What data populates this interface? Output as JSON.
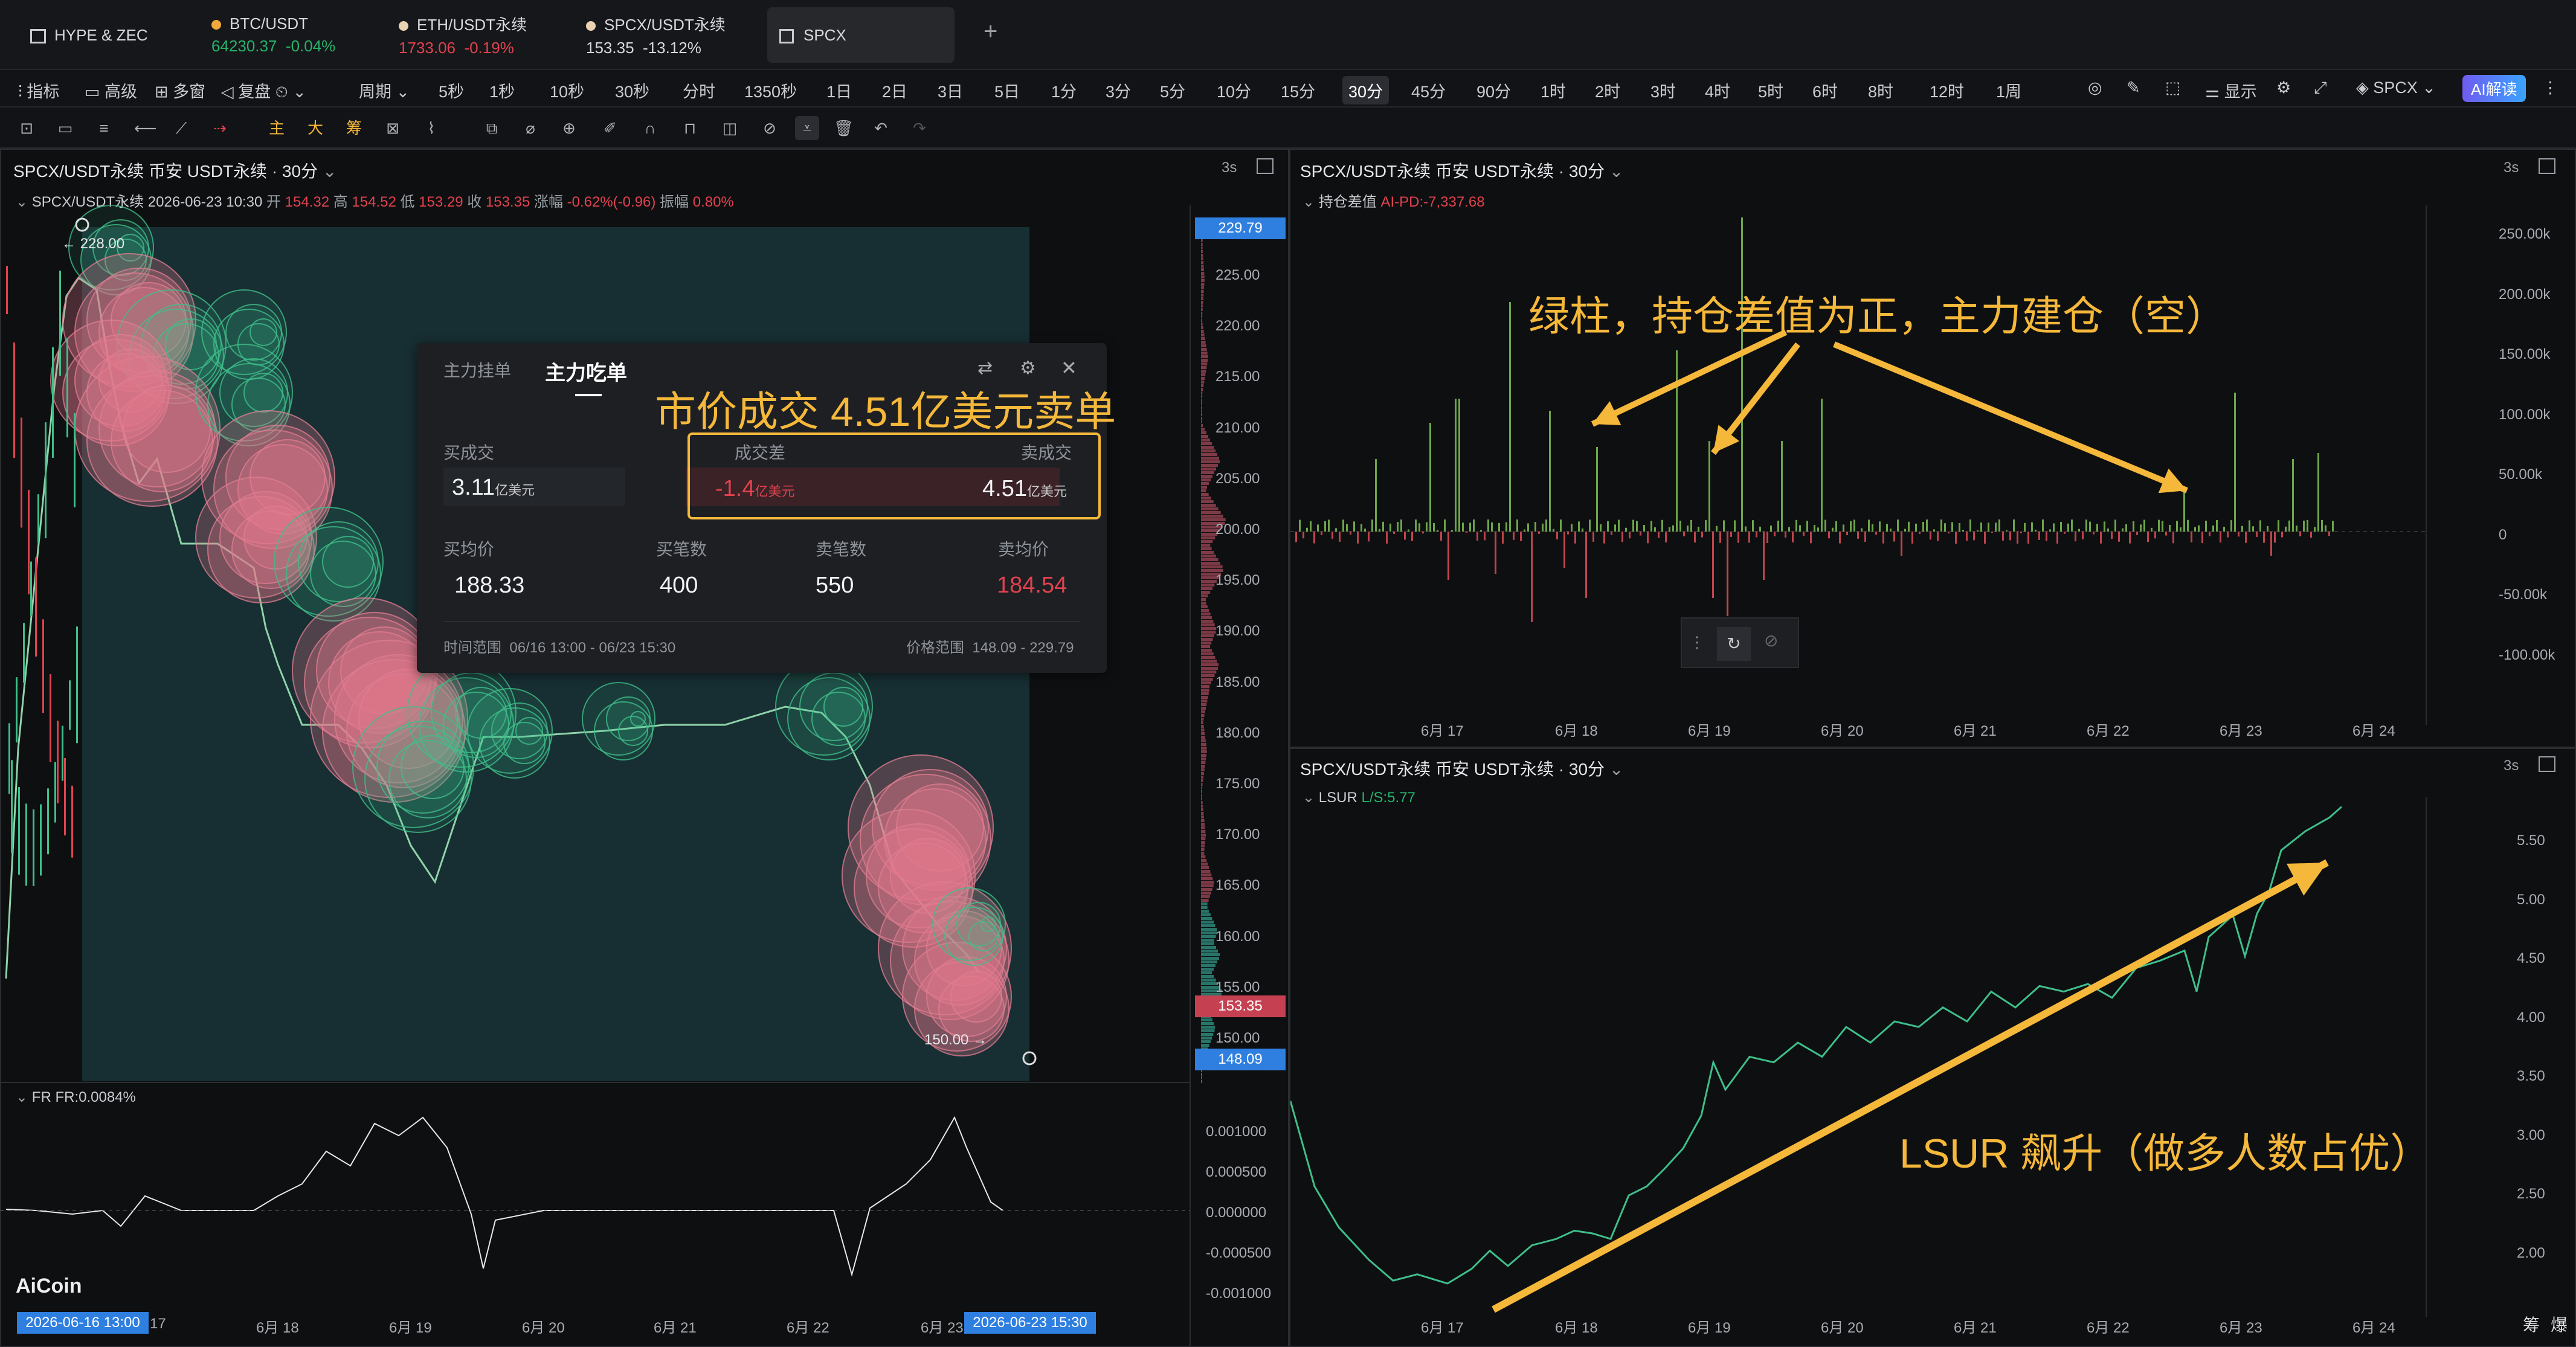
{
  "tabs": [
    {
      "name": "HYPE & ZEC",
      "price": "",
      "change": "",
      "color": ""
    },
    {
      "name": "BTC/USDT",
      "price": "64230.37",
      "change": "-0.04%",
      "color": "#26b36b"
    },
    {
      "name": "ETH/USDT永续",
      "price": "1733.06",
      "change": "-0.19%",
      "color": "#e0424f"
    },
    {
      "name": "SPCX/USDT永续",
      "price": "153.35",
      "change": "-13.12%",
      "color": "#d7d9dd"
    },
    {
      "name": "SPCX",
      "price": "",
      "change": "",
      "color": ""
    }
  ],
  "toolbar": {
    "left": [
      "指标",
      "高级",
      "多窗",
      "复盘"
    ],
    "period": "周期",
    "intervals": [
      "5秒",
      "1秒",
      "10秒",
      "30秒",
      "分时",
      "1350秒",
      "1日",
      "2日",
      "3日",
      "5日",
      "1分",
      "3分",
      "5分",
      "10分",
      "15分",
      "30分",
      "45分",
      "90分",
      "1时",
      "2时",
      "3时",
      "4时",
      "5时",
      "6时",
      "8时",
      "12时",
      "1周"
    ],
    "selected": "30分",
    "right": [
      "显示",
      "SPCX",
      "AI解读"
    ]
  },
  "main_chart": {
    "title": "SPCX/USDT永续 币安 USDT永续 · 30分",
    "refresh": "3s",
    "ohlc_label": "SPCX/USDT永续  2026-06-23 10:30",
    "ohlc": [
      {
        "k": "开",
        "v": "154.32"
      },
      {
        "k": "高",
        "v": "154.52"
      },
      {
        "k": "低",
        "v": "153.29"
      },
      {
        "k": "收",
        "v": "153.35"
      },
      {
        "k": "涨幅",
        "v": "-0.62%(-0.96)"
      },
      {
        "k": "振幅",
        "v": "0.80%"
      }
    ],
    "high_marker": "← 228.00",
    "low_marker": "150.00 →",
    "price_axis": [
      "225.00",
      "220.00",
      "215.00",
      "210.00",
      "205.00",
      "200.00",
      "195.00",
      "190.00",
      "185.00",
      "180.00",
      "175.00",
      "170.00",
      "165.00",
      "160.00",
      "155.00",
      "150.00"
    ],
    "top_tag": "229.79",
    "current_tag": "153.35",
    "bottom_tag": "148.09",
    "fr_label": "FR",
    "fr_value": "FR:0.0084%",
    "fr_axis": [
      "0.001000",
      "0.000500",
      "0.000000",
      "-0.000500",
      "-0.001000"
    ],
    "x_axis": [
      "17",
      "6月 18",
      "6月 19",
      "6月 20",
      "6月 21",
      "6月 22",
      "6月 23"
    ],
    "start_tag": "2026-06-16 13:00",
    "end_tag": "2026-06-23 15:30",
    "logo": "AiCoin"
  },
  "popup": {
    "tab1": "主力挂单",
    "tab2": "主力吃单",
    "buy_label": "买成交",
    "buy_value": "3.11",
    "unit": "亿美元",
    "diff_label": "成交差",
    "diff_value": "-1.4",
    "sell_label": "卖成交",
    "sell_value": "4.51",
    "avg_buy_label": "买均价",
    "avg_buy": "188.33",
    "buy_count_label": "买笔数",
    "buy_count": "400",
    "sell_count_label": "卖笔数",
    "sell_count": "550",
    "avg_sell_label": "卖均价",
    "avg_sell": "184.54",
    "time_label": "时间范围",
    "time_value": "06/16 13:00 - 06/23 15:30",
    "price_label": "价格范围",
    "price_value": "148.09 - 229.79"
  },
  "annot_main": "市价成交 4.51亿美元卖单",
  "oi_chart": {
    "title": "SPCX/USDT永续 币安 USDT永续 · 30分",
    "refresh": "3s",
    "indicator": "持仓差值",
    "value": "AI-PD:-7,337.68",
    "axis": [
      "250.00k",
      "200.00k",
      "150.00k",
      "100.00k",
      "50.00k",
      "0",
      "-50.00k",
      "-100.00k"
    ],
    "x_axis": [
      "6月 17",
      "6月 18",
      "6月 19",
      "6月 20",
      "6月 21",
      "6月 22",
      "6月 23",
      "6月 24"
    ],
    "annotation": "绿柱，持仓差值为正，主力建仓（空）"
  },
  "lsur_chart": {
    "title": "SPCX/USDT永续 币安 USDT永续 · 30分",
    "refresh": "3s",
    "indicator": "LSUR",
    "value": "L/S:5.77",
    "axis": [
      "5.50",
      "5.00",
      "4.50",
      "4.00",
      "3.50",
      "3.00",
      "2.50",
      "2.00"
    ],
    "x_axis": [
      "6月 17",
      "6月 18",
      "6月 19",
      "6月 20",
      "6月 21",
      "6月 22",
      "6月 23",
      "6月 24"
    ],
    "annotation": "LSUR 飙升（做多人数占优）",
    "footer": [
      "筹",
      "爆"
    ]
  },
  "colors": {
    "green": "#26b36b",
    "red": "#e0424f",
    "accent": "#f5b83a",
    "blue": "#2f7fe0"
  }
}
